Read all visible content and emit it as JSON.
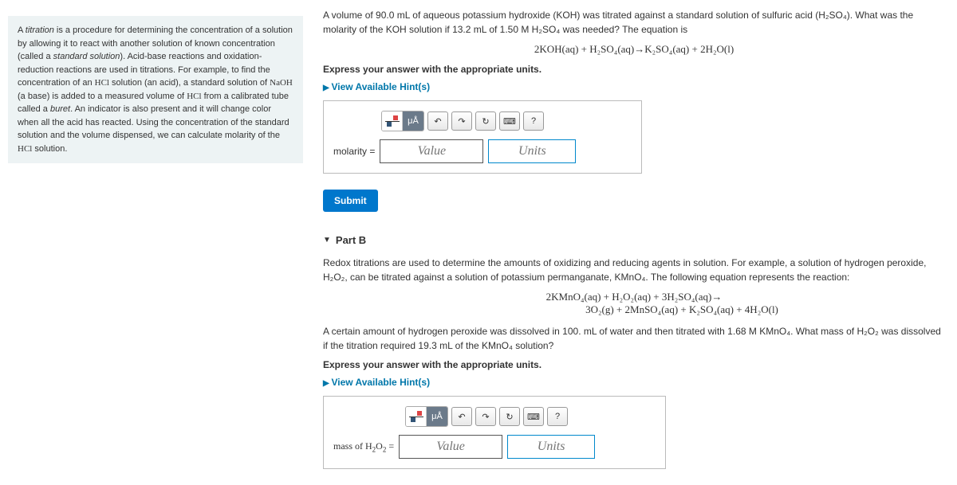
{
  "sidebar": {
    "text": "A *titration* is a procedure for determining the concentration of a solution by allowing it to react with another solution of known concentration (called a *standard solution*). Acid-base reactions and oxidation-reduction reactions are used in titrations. For example, to find the concentration of an HCl solution (an acid), a standard solution of NaOH (a base) is added to a measured volume of HCl from a calibrated tube called a *buret*. An indicator is also present and it will change color when all the acid has reacted. Using the concentration of the standard solution and the volume dispensed, we can calculate molarity of the HCl solution."
  },
  "partA": {
    "problem1": "A volume of 90.0 mL of aqueous potassium hydroxide (KOH) was titrated against a standard solution of sulfuric acid (H₂SO₄). What was the molarity of the KOH solution if  13.2 mL of 1.50 M H₂SO₄ was needed? The equation is",
    "equation": "2KOH(aq) + H₂SO₄(aq)→K₂SO₄(aq) + 2H₂O(l)",
    "instruction": "Express your answer with the appropriate units.",
    "hint": "View Available Hint(s)",
    "label": "molarity = ",
    "valuePlaceholder": "Value",
    "unitsPlaceholder": "Units",
    "submit": "Submit",
    "toolbar": {
      "mu": "μÅ",
      "undo": "↶",
      "redo": "↷",
      "reset": "↻",
      "kb": "⌨",
      "help": "?"
    }
  },
  "partB": {
    "title": "Part B",
    "problem1": "Redox titrations are used to determine the amounts of oxidizing and reducing agents in solution. For example, a solution of hydrogen peroxide, H₂O₂, can be titrated against a solution of potassium permanganate, KMnO₄. The following equation represents the reaction:",
    "equation": "2KMnO₄(aq) + H₂O₂(aq) + 3H₂SO₄(aq)→\n3O₂(g) + 2MnSO₄(aq) + K₂SO₄(aq) + 4H₂O(l)",
    "eq_line1": "2KMnO₄(aq) + H₂O₂(aq) + 3H₂SO₄(aq)→",
    "eq_line2": "3O₂(g) + 2MnSO₄(aq) + K₂SO₄(aq) + 4H₂O(l)",
    "problem2": "A certain amount of hydrogen peroxide was dissolved in 100. mL of water and then titrated with 1.68 M KMnO₄. What mass of H₂O₂ was dissolved if the titration required 19.3 mL of the KMnO₄ solution?",
    "instruction": "Express your answer with the appropriate units.",
    "hint": "View Available Hint(s)",
    "label": "mass of H₂O₂ = ",
    "valuePlaceholder": "Value",
    "unitsPlaceholder": "Units",
    "toolbar": {
      "mu": "μÅ",
      "undo": "↶",
      "redo": "↷",
      "reset": "↻",
      "kb": "⌨",
      "help": "?"
    }
  }
}
